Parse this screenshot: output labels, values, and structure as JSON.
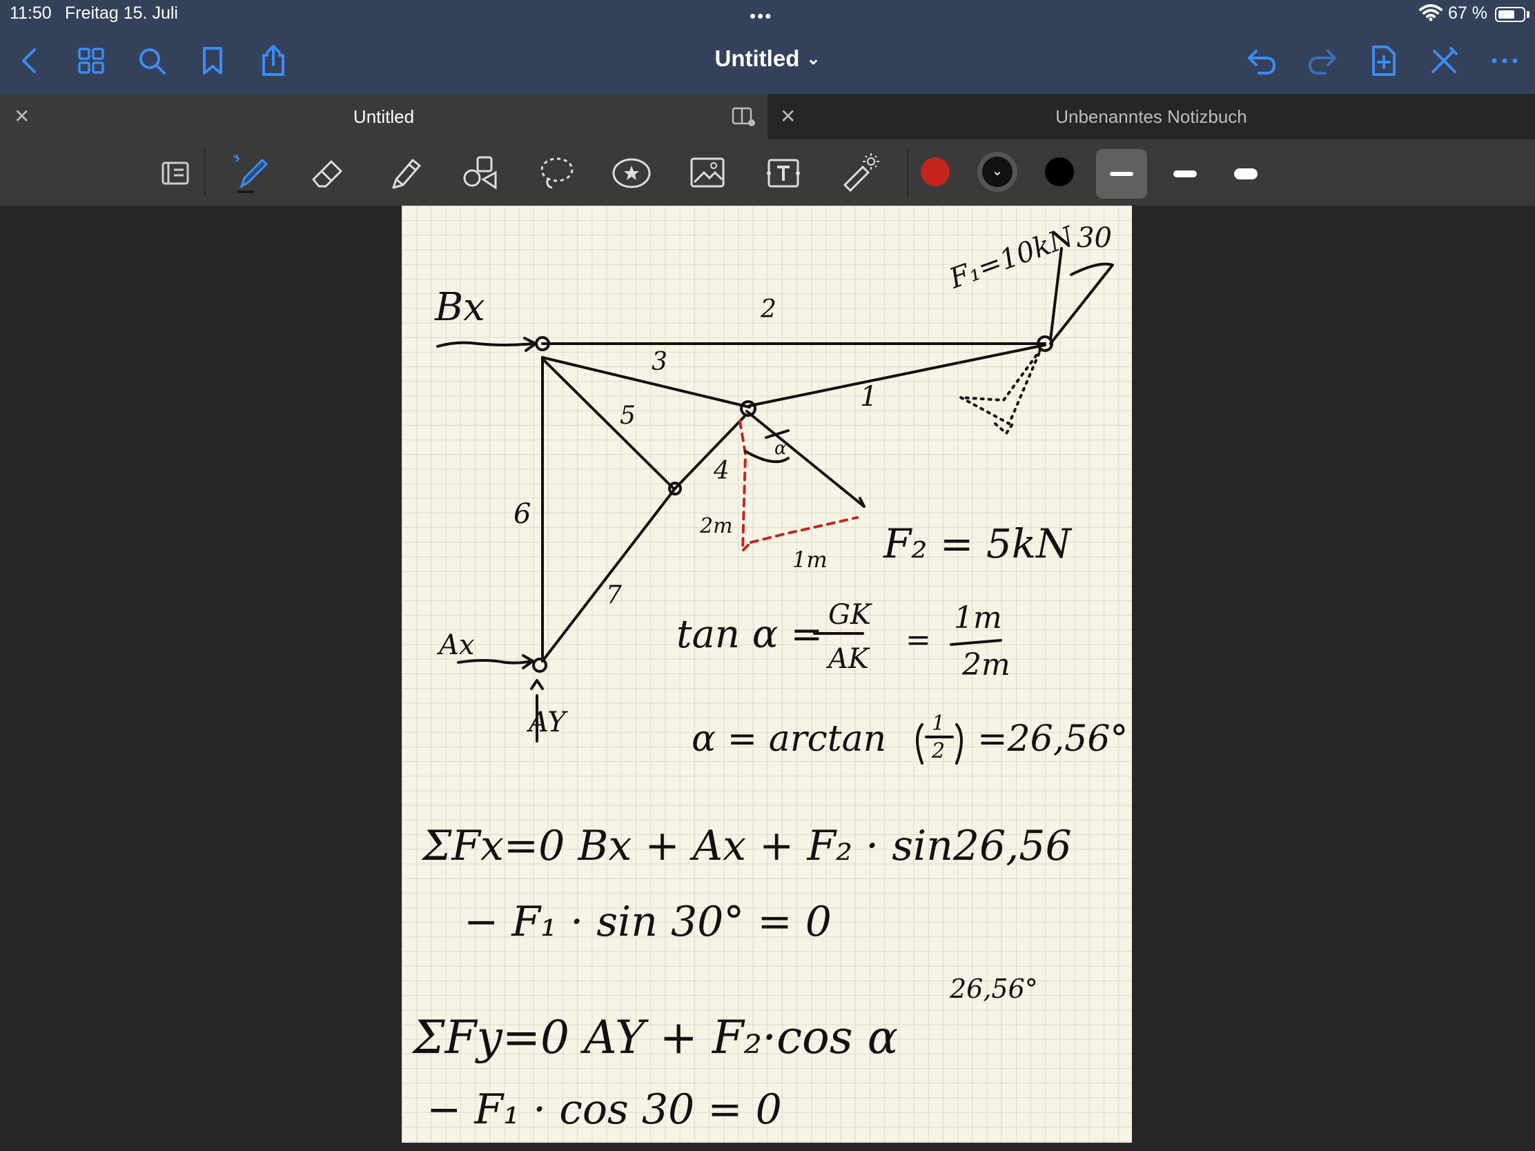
{
  "status_bar": {
    "time": "11:50",
    "date": "Freitag 15. Juli",
    "battery_percent": "67 %",
    "battery_level": 0.67
  },
  "nav_bar": {
    "title": "Untitled",
    "icons": [
      "back-icon",
      "grid-icon",
      "search-icon",
      "bookmark-icon",
      "share-icon",
      "undo-icon",
      "redo-icon",
      "add-page-icon",
      "close-edit-icon",
      "more-icon"
    ],
    "accent_color": "#3b8cf0"
  },
  "tabs": [
    {
      "title": "Untitled",
      "active": true
    },
    {
      "title": "Unbenanntes Notizbuch",
      "active": false
    }
  ],
  "toolbar": {
    "tools": [
      "read-only-icon",
      "pen-icon",
      "eraser-icon",
      "highlighter-icon",
      "shapes-icon",
      "lasso-icon",
      "sticker-icon",
      "image-icon",
      "text-icon",
      "laser-pointer-icon"
    ],
    "selected_tool": "pen",
    "colors": [
      "#c4251e",
      "#111111",
      "#000000"
    ],
    "stroke_widths": [
      "thin",
      "medium",
      "thick"
    ],
    "selected_stroke": "thin"
  },
  "note": {
    "labels": {
      "bx": "Bx",
      "ax": "Ax",
      "ay": "AY",
      "f1": "F₁=10kN",
      "angle30": "30",
      "m2": "2",
      "m3": "3",
      "m1": "1",
      "m5": "5",
      "m4": "4",
      "m6": "6",
      "m7": "7",
      "alpha": "α",
      "len2m": "2m",
      "len1m": "1m",
      "f2": "F₂ = 5kN"
    },
    "equations": {
      "tan_lhs": "tan α =",
      "frac1_num": "GK",
      "frac1_den": "AK",
      "eq": "=",
      "frac2_num": "1m",
      "frac2_den": "2m",
      "arctan": "α = arctan",
      "arctan_num": "1",
      "arctan_den": "2",
      "arctan_result": "=26,56°",
      "sum_fx": "ΣFx=0   Bx + Ax + F₂ · sin26,56",
      "sum_fx_2": "− F₁ · sin 30° = 0",
      "sum_fy_sup": "26,56°",
      "sum_fy": "ΣFy=0  AY + F₂·cos α",
      "sum_fy_2": "− F₁ · cos 30  =  0"
    }
  }
}
